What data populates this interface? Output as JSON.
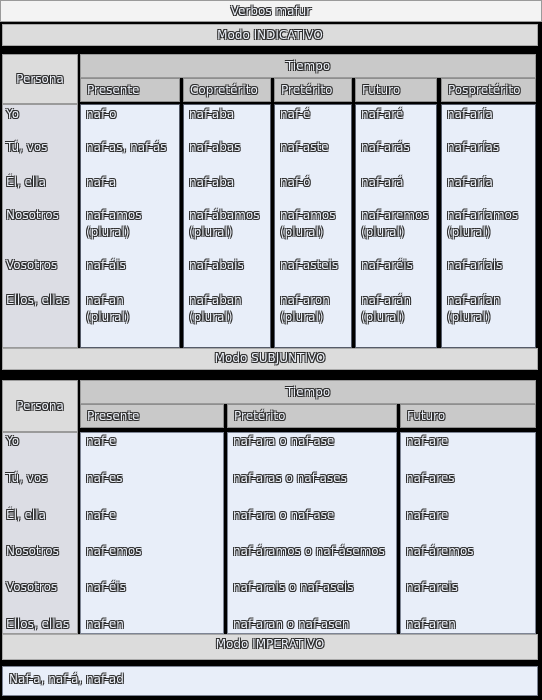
{
  "title": "Verbos mafur",
  "indicativo": {
    "heading": "Modo INDICATIVO",
    "persona_label": "Persona",
    "tiempo_label": "Tiempo",
    "tenses": [
      "Presente",
      "Copretérito",
      "Pretérito",
      "Futuro",
      "Pospretérito"
    ],
    "persons": [
      "Yo",
      "Tú, vos",
      "Él, ella",
      "Nosotros",
      "Vosotros",
      "Ellos, ellas"
    ],
    "cells": [
      [
        "naf-o",
        "naf-aba",
        "naf-é",
        "naf-aré",
        "naf-aría"
      ],
      [
        "naf-as, naf-ás",
        "naf-abas",
        "naf-aste",
        "naf-arás",
        "naf-arías"
      ],
      [
        "naf-a",
        "naf-aba",
        "naf-ó",
        "naf-ará",
        "naf-aría"
      ],
      [
        [
          "naf-amos",
          "(plural)"
        ],
        [
          "naf-ábamos",
          "(plural)"
        ],
        [
          "naf-amos",
          "(plural)"
        ],
        [
          "naf-aremos",
          "(plural)"
        ],
        [
          "naf-aríamos",
          "(plural)"
        ]
      ],
      [
        "naf-áis",
        "naf-abais",
        "naf-asteis",
        "naf-aréis",
        "naf-aríais"
      ],
      [
        [
          "naf-an",
          "(plural)"
        ],
        [
          "naf-aban",
          "(plural)"
        ],
        [
          "naf-aron",
          "(plural)"
        ],
        [
          "naf-arán",
          "(plural)"
        ],
        [
          "naf-arían",
          "(plural)"
        ]
      ]
    ]
  },
  "subjuntivo": {
    "heading": "Modo SUBJUNTIVO",
    "persona_label": "Persona",
    "tiempo_label": "Tiempo",
    "tenses": [
      "Presente",
      "Pretérito",
      "Futuro"
    ],
    "persons": [
      "Yo",
      "Tú, vos",
      "Él, ella",
      "Nosotros",
      "Vosotros",
      "Ellos, ellas"
    ],
    "cells": [
      [
        "naf-e",
        "naf-ara o naf-ase",
        "naf-are"
      ],
      [
        "naf-es",
        "naf-aras o naf-ases",
        "naf-ares"
      ],
      [
        "naf-e",
        "naf-ara o naf-ase",
        "naf-are"
      ],
      [
        "naf-emos",
        "naf-áramos o naf-ásemos",
        "naf-áremos"
      ],
      [
        "naf-éis",
        "naf-arais o naf-aseis",
        "naf-areis"
      ],
      [
        "naf-en",
        "naf-aran o naf-asen",
        "naf-aren"
      ]
    ]
  },
  "imperativo": {
    "heading": "Modo IMPERATIVO",
    "forms": "Naf-a, naf-á, naf-ad"
  }
}
